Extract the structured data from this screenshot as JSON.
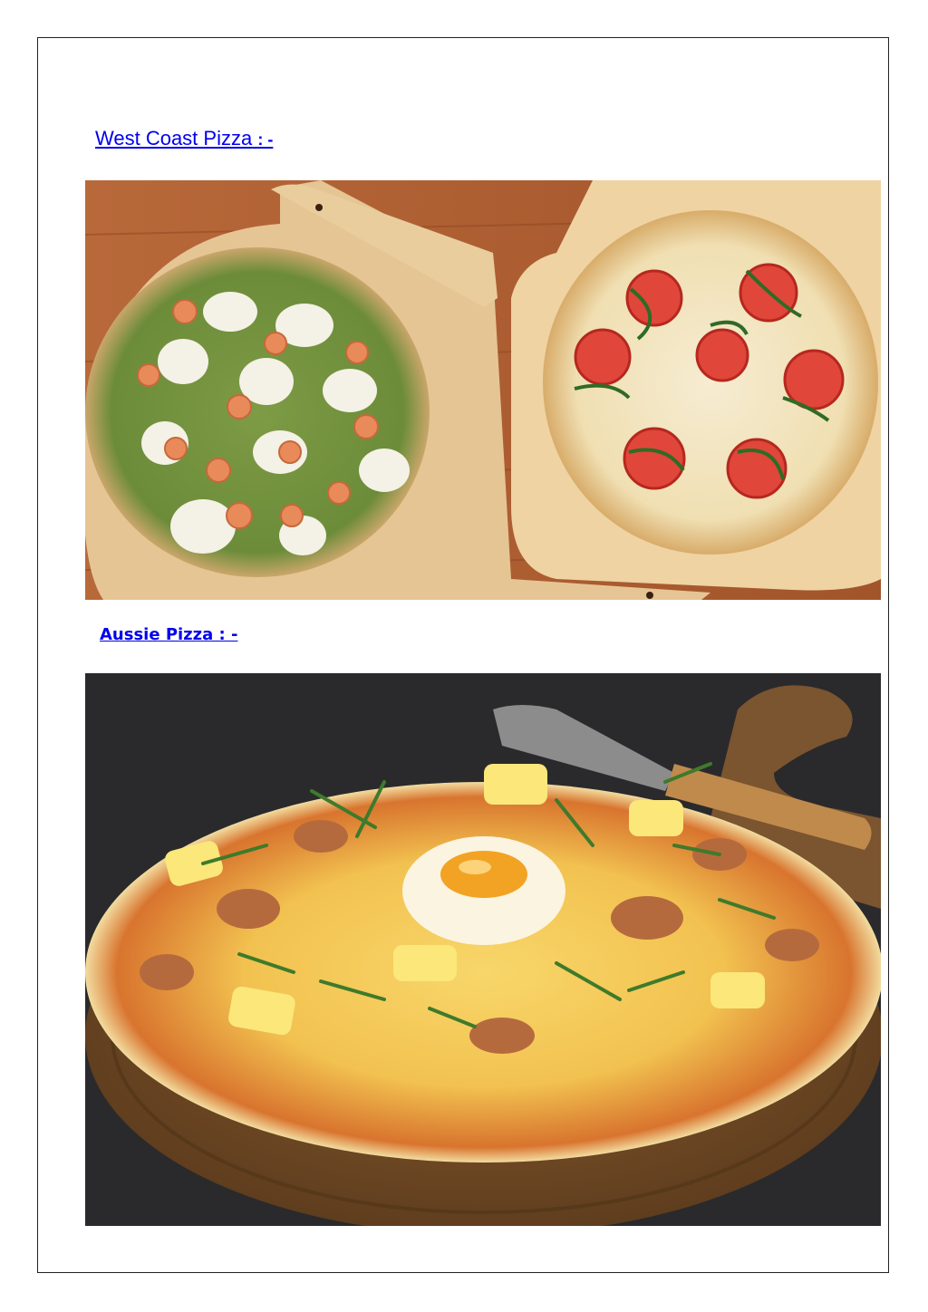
{
  "sections": [
    {
      "title": "West Coast Pizza",
      "separator": ": -",
      "image_subject": "pesto-shrimp-and-tomato-pizzas-on-wooden-paddles"
    },
    {
      "title": "Aussie Pizza : -",
      "image_subject": "egg-ham-pineapple-pizza-on-wooden-board"
    }
  ],
  "colors": {
    "link": "#0000ee",
    "border": "#222222"
  }
}
